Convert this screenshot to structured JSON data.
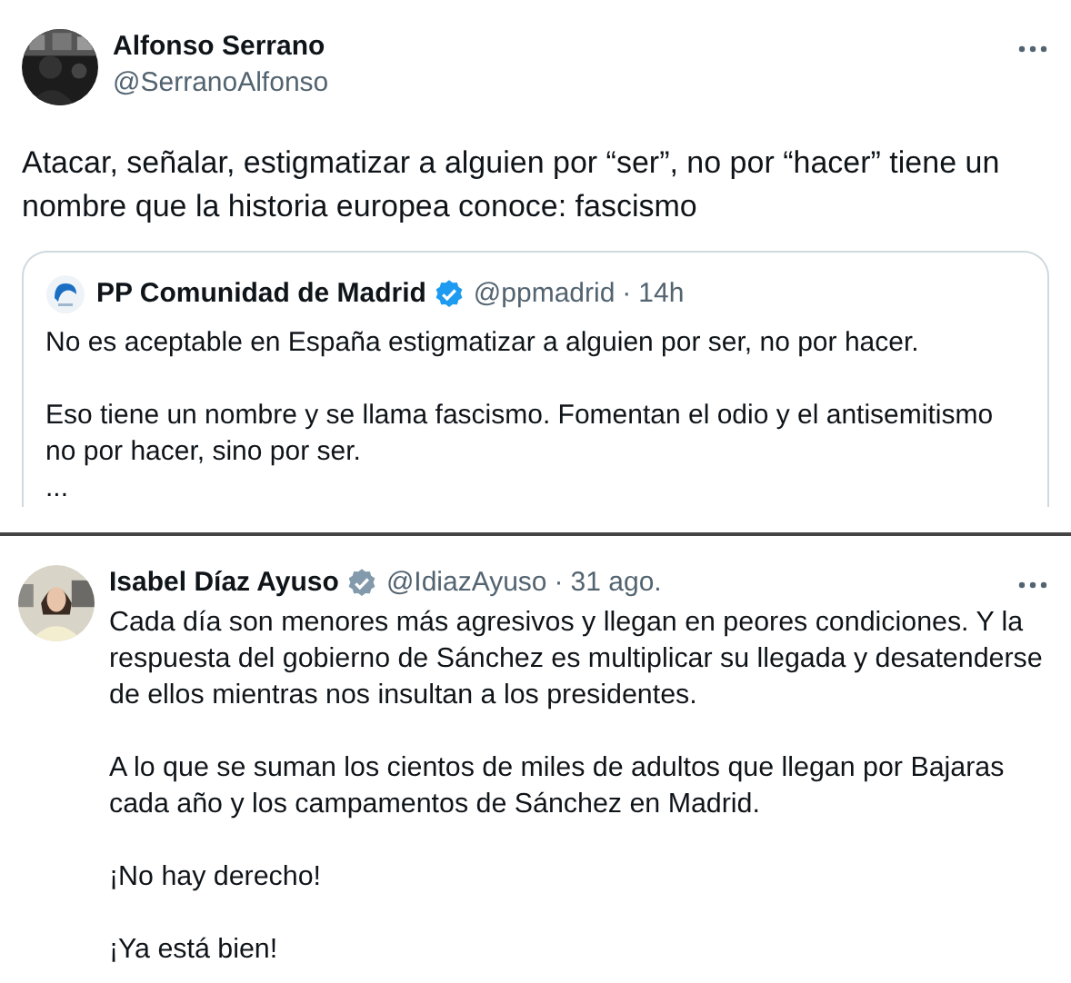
{
  "tweets": [
    {
      "kind": "quote_tweet",
      "author": {
        "name": "Alfonso Serrano",
        "handle": "@SerranoAlfonso"
      },
      "text": "Atacar, señalar, estigmatizar a alguien por “ser”, no por “hacer” tiene un nombre que la historia europea conoce: fascismo",
      "quoted": {
        "author": {
          "name": "PP Comunidad de Madrid",
          "verified": true,
          "color": "#1d9bf0",
          "handle": "@ppmadrid",
          "separator": "·",
          "time": "14h"
        },
        "paragraphs": [
          "No es aceptable en España estigmatizar a alguien por ser, no por hacer.",
          "Eso tiene un nombre y se llama fascismo. Fomentan el odio y el antisemitismo no por hacer, sino por ser.",
          "..."
        ]
      }
    },
    {
      "kind": "tweet",
      "author": {
        "name": "Isabel Díaz Ayuso",
        "verified": true,
        "color": "#829aab",
        "handle": "@IdiazAyuso",
        "separator": "·",
        "time": "31 ago."
      },
      "paragraphs": [
        "Cada día son menores más agresivos y llegan en peores condiciones. Y la respuesta del gobierno de Sánchez es multiplicar su llegada y desatenderse de ellos mientras nos insultan a los presidentes.",
        "A lo que se suman los cientos de miles de adultos que llegan por Bajaras cada año y los campamentos de Sánchez en Madrid.",
        "¡No hay derecho!",
        "¡Ya está bien!"
      ]
    }
  ]
}
